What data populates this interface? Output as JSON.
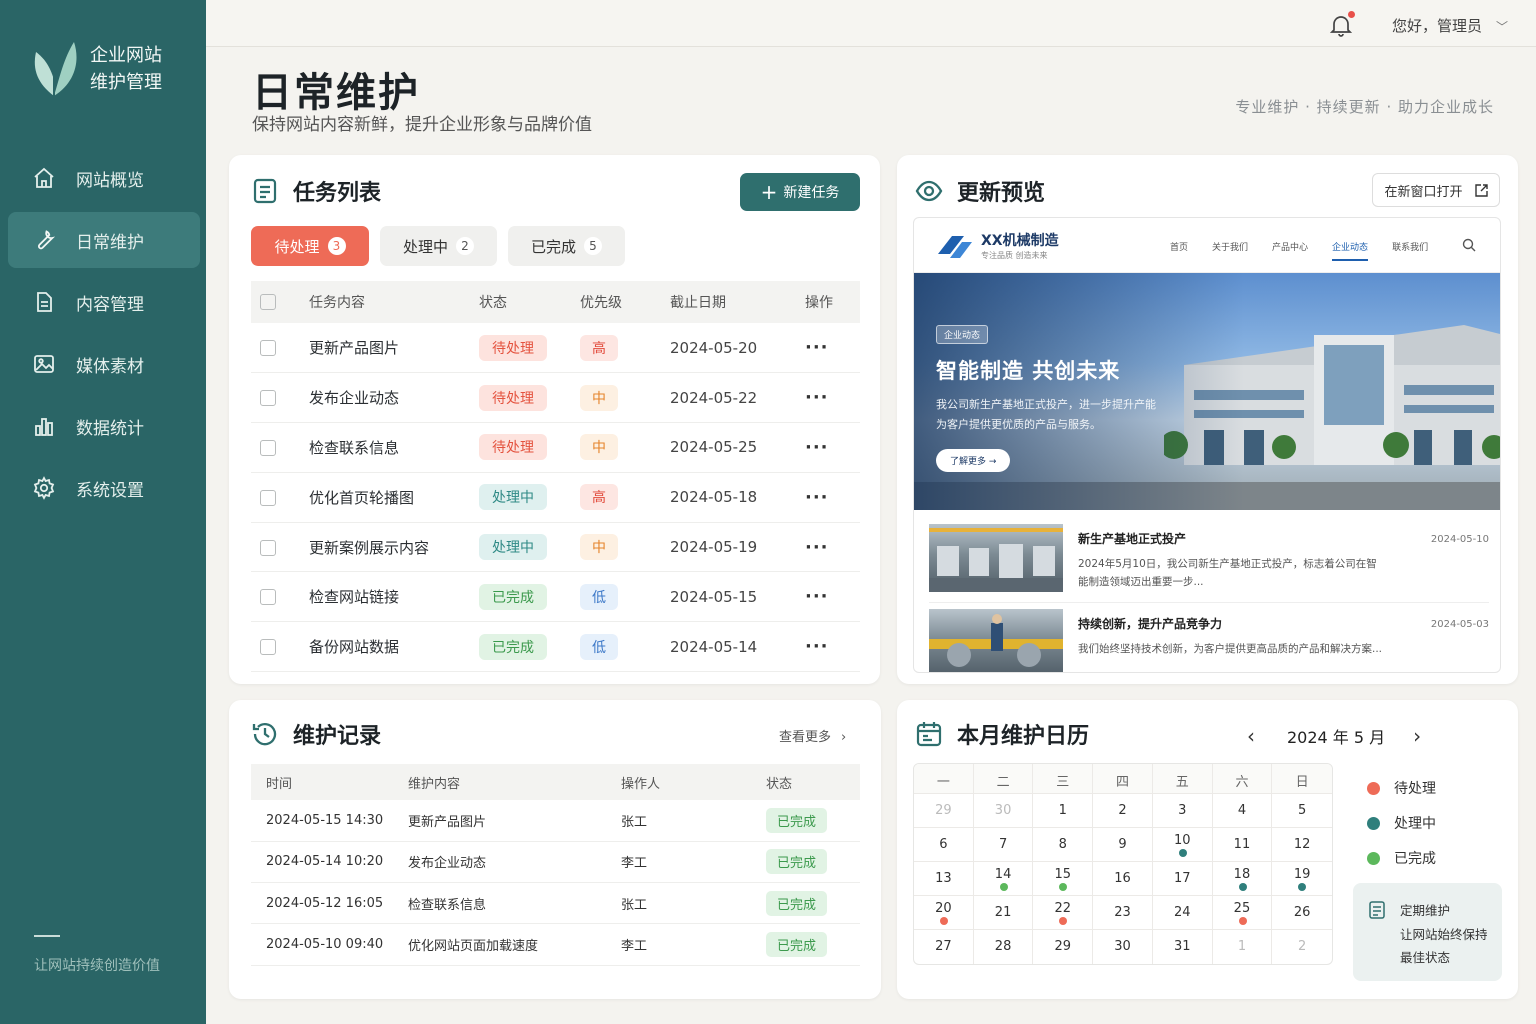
{
  "sidebar": {
    "brand_line1": "企业网站",
    "brand_line2": "维护管理",
    "items": [
      {
        "label": "网站概览",
        "icon": "home-icon"
      },
      {
        "label": "日常维护",
        "icon": "wrench-icon",
        "active": true
      },
      {
        "label": "内容管理",
        "icon": "document-icon"
      },
      {
        "label": "媒体素材",
        "icon": "image-icon"
      },
      {
        "label": "数据统计",
        "icon": "bar-chart-icon"
      },
      {
        "label": "系统设置",
        "icon": "gear-icon"
      }
    ],
    "footer": "让网站持续创造价值"
  },
  "topbar": {
    "greeting": "您好，管理员"
  },
  "header": {
    "title": "日常维护",
    "subtitle": "保持网站内容新鲜，提升企业形象与品牌价值",
    "slogan": "专业维护 · 持续更新 · 助力企业成长"
  },
  "tasks": {
    "title": "任务列表",
    "new_button": "新建任务",
    "tabs": [
      {
        "label": "待处理",
        "count": "3"
      },
      {
        "label": "处理中",
        "count": "2"
      },
      {
        "label": "已完成",
        "count": "5"
      }
    ],
    "columns": [
      "任务内容",
      "状态",
      "优先级",
      "截止日期",
      "操作"
    ],
    "rows": [
      {
        "name": "更新产品图片",
        "status": "待处理",
        "priority": "高",
        "date": "2024-05-20"
      },
      {
        "name": "发布企业动态",
        "status": "待处理",
        "priority": "中",
        "date": "2024-05-22"
      },
      {
        "name": "检查联系信息",
        "status": "待处理",
        "priority": "中",
        "date": "2024-05-25"
      },
      {
        "name": "优化首页轮播图",
        "status": "处理中",
        "priority": "高",
        "date": "2024-05-18"
      },
      {
        "name": "更新案例展示内容",
        "status": "处理中",
        "priority": "中",
        "date": "2024-05-19"
      },
      {
        "name": "检查网站链接",
        "status": "已完成",
        "priority": "低",
        "date": "2024-05-15"
      },
      {
        "name": "备份网站数据",
        "status": "已完成",
        "priority": "低",
        "date": "2024-05-14"
      }
    ],
    "more": "···"
  },
  "preview": {
    "title": "更新预览",
    "open_button": "在新窗口打开",
    "site": {
      "name": "XX机械制造",
      "tagline": "专注品质  创造未来",
      "menu": [
        "首页",
        "关于我们",
        "产品中心",
        "企业动态",
        "联系我们"
      ],
      "badge": "企业动态",
      "headline": "智能制造  共创未来",
      "desc_line1": "我公司新生产基地正式投产，进一步提升产能",
      "desc_line2": "为客户提供更优质的产品与服务。",
      "cta": "了解更多 →",
      "news": [
        {
          "title": "新生产基地正式投产",
          "desc_line1": "2024年5月10日，我公司新生产基地正式投产，标志着公司在智",
          "desc_line2": "能制造领域迈出重要一步...",
          "date": "2024-05-10"
        },
        {
          "title": "持续创新，提升产品竞争力",
          "desc_line1": "我们始终坚持技术创新，为客户提供更高品质的产品和解决方案...",
          "desc_line2": "",
          "date": "2024-05-03"
        }
      ]
    }
  },
  "records": {
    "title": "维护记录",
    "see_more": "查看更多",
    "columns": [
      "时间",
      "维护内容",
      "操作人",
      "状态"
    ],
    "rows": [
      {
        "time": "2024-05-15 14:30",
        "content": "更新产品图片",
        "operator": "张工",
        "status": "已完成"
      },
      {
        "time": "2024-05-14 10:20",
        "content": "发布企业动态",
        "operator": "李工",
        "status": "已完成"
      },
      {
        "time": "2024-05-12 16:05",
        "content": "检查联系信息",
        "operator": "张工",
        "status": "已完成"
      },
      {
        "time": "2024-05-10 09:40",
        "content": "优化网站页面加载速度",
        "operator": "李工",
        "status": "已完成"
      }
    ]
  },
  "calendar": {
    "title": "本月维护日历",
    "month": "2024 年 5 月",
    "weekdays": [
      "一",
      "二",
      "三",
      "四",
      "五",
      "六",
      "日"
    ],
    "weeks": [
      [
        {
          "d": "29",
          "m": true
        },
        {
          "d": "30",
          "m": true
        },
        {
          "d": "1"
        },
        {
          "d": "2"
        },
        {
          "d": "3"
        },
        {
          "d": "4"
        },
        {
          "d": "5"
        }
      ],
      [
        {
          "d": "6"
        },
        {
          "d": "7"
        },
        {
          "d": "8"
        },
        {
          "d": "9"
        },
        {
          "d": "10",
          "dot": "doing"
        },
        {
          "d": "11"
        },
        {
          "d": "12"
        }
      ],
      [
        {
          "d": "13"
        },
        {
          "d": "14",
          "dot": "done"
        },
        {
          "d": "15",
          "dot": "done"
        },
        {
          "d": "16"
        },
        {
          "d": "17"
        },
        {
          "d": "18",
          "dot": "doing"
        },
        {
          "d": "19",
          "dot": "doing"
        }
      ],
      [
        {
          "d": "20",
          "dot": "pending"
        },
        {
          "d": "21"
        },
        {
          "d": "22",
          "dot": "pending"
        },
        {
          "d": "23"
        },
        {
          "d": "24"
        },
        {
          "d": "25",
          "dot": "pending"
        },
        {
          "d": "26"
        }
      ],
      [
        {
          "d": "27"
        },
        {
          "d": "28"
        },
        {
          "d": "29"
        },
        {
          "d": "30"
        },
        {
          "d": "31"
        },
        {
          "d": "1",
          "m": true
        },
        {
          "d": "2",
          "m": true
        }
      ]
    ],
    "legend": [
      {
        "label": "待处理",
        "key": "pending"
      },
      {
        "label": "处理中",
        "key": "doing"
      },
      {
        "label": "已完成",
        "key": "done"
      }
    ],
    "tip_title": "定期维护",
    "tip_line1": "让网站始终保持",
    "tip_line2": "最佳状态"
  },
  "colors": {
    "pending": "#ee6b57",
    "doing": "#2f7f7c",
    "done": "#5cb85c",
    "sidebar": "#2a6566"
  }
}
